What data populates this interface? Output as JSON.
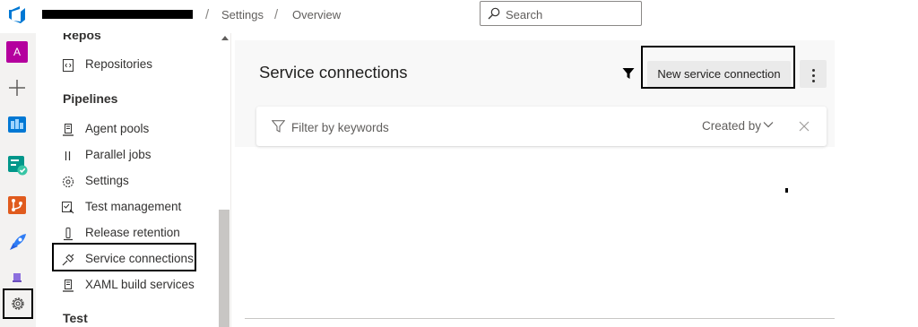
{
  "topbar": {
    "breadcrumbs": [
      "Settings",
      "Overview"
    ],
    "search_placeholder": "Search"
  },
  "rail": {
    "avatar_letter": "A",
    "items": [
      "avatar",
      "add-icon",
      "boards-icon",
      "test-plans-icon",
      "repos-icon",
      "pipelines-icon",
      "artifacts-icon",
      "gear-icon"
    ]
  },
  "nav": {
    "sections": [
      {
        "heading": "Repos",
        "items": [
          {
            "label": "Repositories",
            "icon": "repo-icon"
          }
        ]
      },
      {
        "heading": "Pipelines",
        "items": [
          {
            "label": "Agent pools",
            "icon": "agent-pool-icon"
          },
          {
            "label": "Parallel jobs",
            "icon": "parallel-icon"
          },
          {
            "label": "Settings",
            "icon": "gear-icon"
          },
          {
            "label": "Test management",
            "icon": "test-management-icon"
          },
          {
            "label": "Release retention",
            "icon": "retention-icon"
          },
          {
            "label": "Service connections",
            "icon": "link-icon"
          },
          {
            "label": "XAML build services",
            "icon": "build-icon"
          }
        ]
      },
      {
        "heading": "Test",
        "items": []
      }
    ]
  },
  "main": {
    "title": "Service connections",
    "new_button": "New service connection",
    "filter_placeholder": "Filter by keywords",
    "created_by": "Created by"
  },
  "colors": {
    "accent": "#0078d4",
    "avatar_bg": "#b4009e",
    "rail_bg": "#f3f2f1",
    "header_bg": "#f8f8f8"
  }
}
